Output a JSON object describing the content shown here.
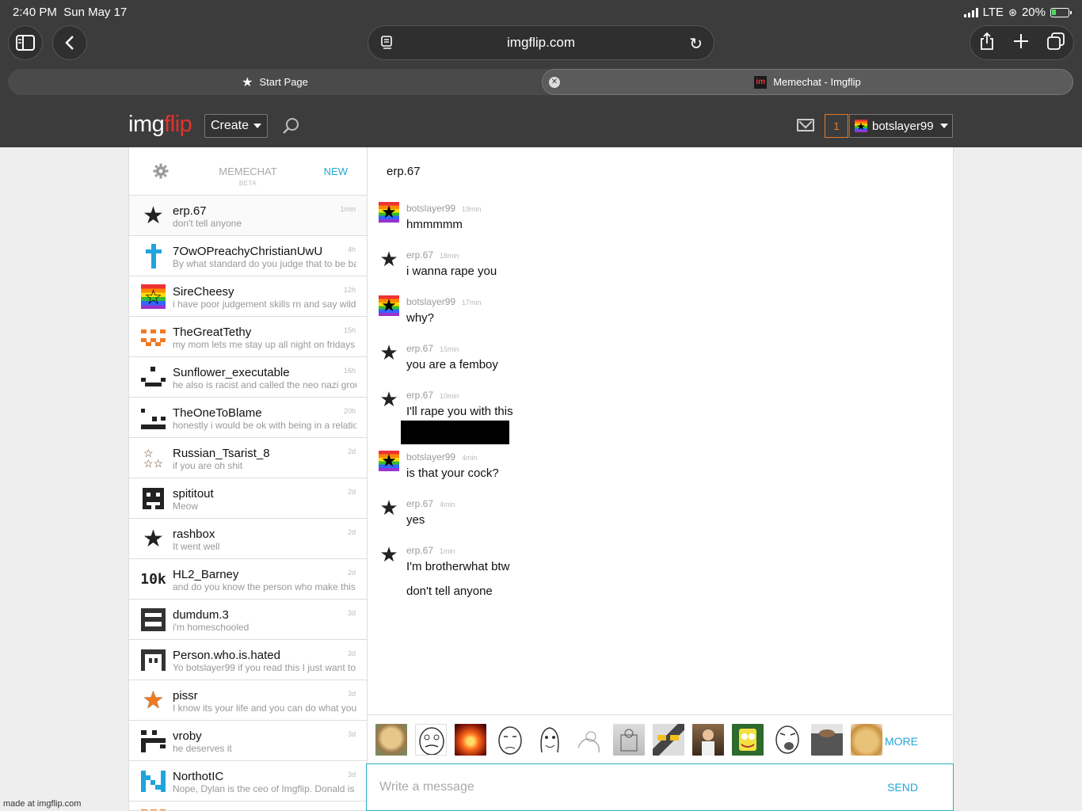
{
  "status_bar": {
    "time": "2:40 PM",
    "date": "Sun May 17",
    "network": "LTE",
    "battery": "20%"
  },
  "browser": {
    "url": "imgflip.com",
    "tabs": [
      {
        "label": "Start Page"
      },
      {
        "label": "Memechat - Imgflip"
      }
    ]
  },
  "header": {
    "logo_img": "img",
    "logo_flip": "flip",
    "create_label": "Create",
    "notification_count": "1",
    "username": "botslayer99"
  },
  "sidebar": {
    "title": "MEMECHAT",
    "beta": "BETA",
    "new_label": "NEW",
    "conversations": [
      {
        "name": "erp.67",
        "preview": "don't tell anyone",
        "time": "1min"
      },
      {
        "name": "7OwOPreachyChristianUwU",
        "preview": "By what standard do you judge that to be bad",
        "time": "4h"
      },
      {
        "name": "SireCheesy",
        "preview": "i have poor judgement skills rn and say wild",
        "time": "12h"
      },
      {
        "name": "TheGreatTethy",
        "preview": "my mom lets me stay up all night on fridays",
        "time": "15h"
      },
      {
        "name": "Sunflower_executable",
        "preview": "he also is racist and called the neo nazi group",
        "time": "16h"
      },
      {
        "name": "TheOneToBlame",
        "preview": "honestly i would be ok with being in a relationship",
        "time": "20h"
      },
      {
        "name": "Russian_Tsarist_8",
        "preview": "if you are oh shit",
        "time": "2d"
      },
      {
        "name": "spititout",
        "preview": "Meow",
        "time": "2d"
      },
      {
        "name": "rashbox",
        "preview": "It went well",
        "time": "2d"
      },
      {
        "name": "HL2_Barney",
        "preview": "and do you know the person who make this",
        "time": "2d"
      },
      {
        "name": "dumdum.3",
        "preview": "i'm homeschooled",
        "time": "3d"
      },
      {
        "name": "Person.who.is.hated",
        "preview": "Yo botslayer99 if you read this I just want to",
        "time": "3d"
      },
      {
        "name": "pissr",
        "preview": "I know its your life and you can do what you",
        "time": "3d"
      },
      {
        "name": "vroby",
        "preview": "he deserves it",
        "time": "3d"
      },
      {
        "name": "NorthotIC",
        "preview": "Nope, Dylan is the ceo of Imgflip. Donald is",
        "time": "3d"
      }
    ],
    "avatar_text_10k": "10k"
  },
  "chat": {
    "title": "erp.67",
    "messages": [
      {
        "user": "botslayer99",
        "time": "19min",
        "text": "hmmmmm"
      },
      {
        "user": "erp.67",
        "time": "18min",
        "text": "i wanna rape you"
      },
      {
        "user": "botslayer99",
        "time": "17min",
        "text": "why?"
      },
      {
        "user": "erp.67",
        "time": "15min",
        "text": "you are a femboy"
      },
      {
        "user": "erp.67",
        "time": "10min",
        "text": "I'll rape you with this"
      },
      {
        "user": "botslayer99",
        "time": "4min",
        "text": "is that your cock?"
      },
      {
        "user": "erp.67",
        "time": "4min",
        "text": "yes"
      },
      {
        "user": "erp.67",
        "time": "1min",
        "text": "I'm brotherwhat btw"
      }
    ],
    "extra_line": "don't tell anyone",
    "more_label": "MORE",
    "composer_placeholder": "Write a message",
    "send_label": "SEND"
  },
  "watermark": "made at imgflip.com",
  "colors": {
    "accent": "#23a7d7",
    "brand_red": "#e0342f",
    "header_bg": "#3c3c3c",
    "notif_orange": "#e07a2e"
  }
}
